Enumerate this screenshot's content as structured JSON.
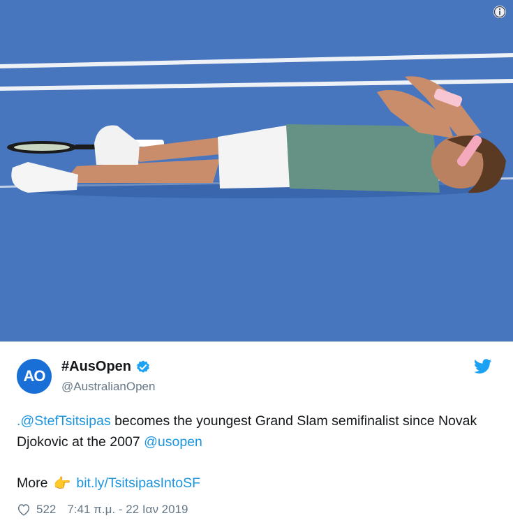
{
  "photo": {
    "alt_icon": "info-icon",
    "colors": {
      "court": "#4a79c2",
      "lines": "#f2f4f7"
    }
  },
  "tweet": {
    "avatar_text": "AO",
    "display_name": "#AusOpen",
    "verified_icon": "verified-badge-icon",
    "handle": "@AustralianOpen",
    "brand_icon": "twitter-bird-icon",
    "text_parts": {
      "mention1": ".@StefTsitsipas",
      "body1": " becomes the youngest Grand Slam semifinalist since Novak Djokovic at the 2007 ",
      "mention2": "@usopen"
    },
    "more_label": "More",
    "more_emoji": "👉",
    "more_link": "bit.ly/TsitsipasIntoSF",
    "likes": "522",
    "timestamp": "7:41 π.μ. - 22 Ιαν 2019",
    "colors": {
      "link": "#1b95e0",
      "text": "#14171a",
      "muted": "#657786",
      "brand": "#1da1f2"
    }
  }
}
